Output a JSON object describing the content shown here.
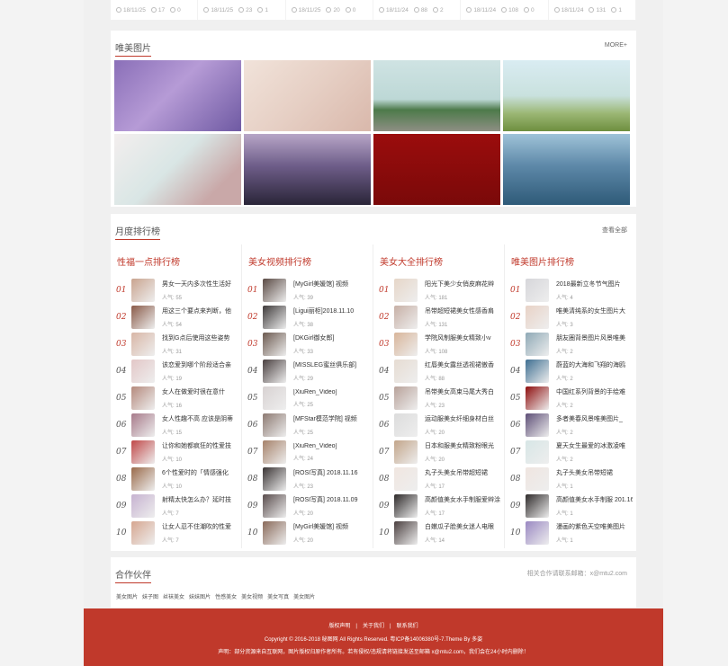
{
  "top_strip": [
    {
      "date": "18/11/25",
      "views": "17",
      "likes": "0"
    },
    {
      "date": "18/11/25",
      "views": "23",
      "likes": "1"
    },
    {
      "date": "18/11/25",
      "views": "20",
      "likes": "0"
    },
    {
      "date": "18/11/24",
      "views": "88",
      "likes": "2"
    },
    {
      "date": "18/11/24",
      "views": "108",
      "likes": "0"
    },
    {
      "date": "18/11/24",
      "views": "131",
      "likes": "1"
    }
  ],
  "gallery": {
    "title": "唯美图片",
    "more": "MORE+",
    "tiles": [
      "linear-gradient(135deg,#8a6fb8,#b69bd6 45%,#6f5aa3)",
      "linear-gradient(135deg,#f1e3da,#e6cfc4 50%,#d9b8ab)",
      "linear-gradient(180deg,#cfe3e3 0%,#bdd8d6 55%,#4d7a4a 70%,#8e8f84 100%)",
      "linear-gradient(180deg,#d9ecf2 0%,#c9e1de 50%,#9bb774 75%,#6e8f3f 100%)",
      "linear-gradient(135deg,#f3eeee,#d9e6e5 45%,#c9a8a8 80%)",
      "linear-gradient(180deg,#b7a6c7 0%,#6e5d89 45%,#2a2538 100%)",
      "linear-gradient(180deg,#9b0d0d,#7a0909)",
      "linear-gradient(180deg,#9fc3d8 0%,#5d88a8 45%,#2e5a78 100%)"
    ]
  },
  "ranking": {
    "title": "月度排行榜",
    "more": "查看全部",
    "columns": [
      {
        "title": "性福一点排行榜",
        "items": [
          {
            "num": "01",
            "title": "男女一天内多次性生活好",
            "pop": "人气: 55",
            "thumb": "#c9a48f"
          },
          {
            "num": "02",
            "title": "用这三个要点来判断，他",
            "pop": "人气: 54",
            "thumb": "#8a5a48"
          },
          {
            "num": "03",
            "title": "找到G点后使用这些姿势",
            "pop": "人气: 31",
            "thumb": "#d8b6a6"
          },
          {
            "num": "04",
            "title": "该恋爱到哪个阶段适合亲",
            "pop": "人气: 19",
            "thumb": "#e3c7c7"
          },
          {
            "num": "05",
            "title": "女人在做爱时很在意什",
            "pop": "人气: 16",
            "thumb": "#b58a7d"
          },
          {
            "num": "06",
            "title": "女人性趣不高 应该是阴蒂",
            "pop": "人气: 15",
            "thumb": "#a77a8a"
          },
          {
            "num": "07",
            "title": "让你和她都疯狂的性爱技",
            "pop": "人气: 10",
            "thumb": "#c04848"
          },
          {
            "num": "08",
            "title": "6个性爱时的「情感强化",
            "pop": "人气: 10",
            "thumb": "#9a6a4a"
          },
          {
            "num": "09",
            "title": "射精太快怎么办？延时技",
            "pop": "人气: 7",
            "thumb": "#c6b2d0"
          },
          {
            "num": "10",
            "title": "让女人忍不住潮吹的性爱",
            "pop": "人气: 7",
            "thumb": "#d6a690"
          }
        ]
      },
      {
        "title": "美女视频排行榜",
        "items": [
          {
            "num": "01",
            "title": "[MyGirl美媛馆] 视频",
            "pop": "人气: 39",
            "thumb": "#5a4a44"
          },
          {
            "num": "02",
            "title": "[Ligui丽柜]2018.11.10",
            "pop": "人气: 38",
            "thumb": "#3e3a3a"
          },
          {
            "num": "03",
            "title": "[DKGirl御女郎]",
            "pop": "人气: 33",
            "thumb": "#6c5a50"
          },
          {
            "num": "04",
            "title": "[MISSLEG蜜丝俱乐部]",
            "pop": "人气: 29",
            "thumb": "#4a4040"
          },
          {
            "num": "05",
            "title": "[XiuRen_Video]",
            "pop": "人气: 25",
            "thumb": "#d8d2d2"
          },
          {
            "num": "06",
            "title": "[MFStar模范学院] 视频",
            "pop": "人气: 25",
            "thumb": "#8d7a72"
          },
          {
            "num": "07",
            "title": "[XiuRen_Video]",
            "pop": "人气: 24",
            "thumb": "#a6826a"
          },
          {
            "num": "08",
            "title": "[ROSI写真] 2018.11.16",
            "pop": "人气: 23",
            "thumb": "#3a3434"
          },
          {
            "num": "09",
            "title": "[ROSI写真] 2018.11.09",
            "pop": "人气: 20",
            "thumb": "#5a4d4d"
          },
          {
            "num": "10",
            "title": "[MyGirl美媛馆] 视频",
            "pop": "人气: 20",
            "thumb": "#8a6a5a"
          }
        ]
      },
      {
        "title": "美女大全排行榜",
        "items": [
          {
            "num": "01",
            "title": "阳光下美少女俏皮麻花辫",
            "pop": "人气: 181",
            "thumb": "#e6d6c8"
          },
          {
            "num": "02",
            "title": "吊带超短裙美女性感香肩",
            "pop": "人气: 131",
            "thumb": "#c7b0a6"
          },
          {
            "num": "03",
            "title": "学院风制服美女精致小v",
            "pop": "人气: 108",
            "thumb": "#d8b59a"
          },
          {
            "num": "04",
            "title": "红唇美女露丝透视裙傲香",
            "pop": "人气: 88",
            "thumb": "#e6dcd2"
          },
          {
            "num": "05",
            "title": "吊带美女高束马尾大秀白",
            "pop": "人气: 23",
            "thumb": "#b8a29a"
          },
          {
            "num": "06",
            "title": "运动服美女纤细身材白丝",
            "pop": "人气: 20",
            "thumb": "#dcdcdc"
          },
          {
            "num": "07",
            "title": "日本和服美女精致粉眼光",
            "pop": "人气: 20",
            "thumb": "#c2a58a"
          },
          {
            "num": "08",
            "title": "丸子头美女吊带超短裙",
            "pop": "人气: 17",
            "thumb": "#f0e6e0"
          },
          {
            "num": "09",
            "title": "高颜值美女水手制服爱辫涂",
            "pop": "人气: 17",
            "thumb": "#2e2a2a"
          },
          {
            "num": "10",
            "title": "白嫩瓜子脸美女迷人电眼",
            "pop": "人气: 14",
            "thumb": "#4a3f3f"
          }
        ]
      },
      {
        "title": "唯美图片排行榜",
        "items": [
          {
            "num": "01",
            "title": "2018最新立冬节气图片",
            "pop": "人气: 4",
            "thumb": "#d6d6da"
          },
          {
            "num": "02",
            "title": "唯美清纯系的女生图片大",
            "pop": "人气: 3",
            "thumb": "#e8d2c6"
          },
          {
            "num": "03",
            "title": "朋友圈背景图片风景唯美",
            "pop": "人气: 2",
            "thumb": "#8fa9b6"
          },
          {
            "num": "04",
            "title": "蔚蓝的大海和飞翔的海鸥",
            "pop": "人气: 2",
            "thumb": "#3f6f92"
          },
          {
            "num": "05",
            "title": "中国红系列背景的手绘难",
            "pop": "人气: 2",
            "thumb": "#8e0e0e"
          },
          {
            "num": "06",
            "title": "多者美春风景唯美图片_",
            "pop": "人气: 2",
            "thumb": "#5e4f77"
          },
          {
            "num": "07",
            "title": "夏天女生最爱的冰激凌唯",
            "pop": "人气: 2",
            "thumb": "#d7e6e6"
          },
          {
            "num": "08",
            "title": "丸子头美女吊带短裙",
            "pop": "人气: 1",
            "thumb": "#efe5e0"
          },
          {
            "num": "09",
            "title": "高颜值美女水手制服 201.16",
            "pop": "人气: 1",
            "thumb": "#2f2b2b"
          },
          {
            "num": "10",
            "title": "漫画的紫色天空唯美图片",
            "pop": "人气: 1",
            "thumb": "#9a88c2"
          }
        ]
      }
    ]
  },
  "partners": {
    "title": "合作伙伴",
    "contact": "相关合作请联系邮箱：x@mtu2.com",
    "links": [
      "美女图片",
      "妹子图",
      "丝袜美女",
      "妹妹图片",
      "性感美女",
      "美女视频",
      "美女写真",
      "美女图片"
    ]
  },
  "footer": {
    "links": [
      "版权声明",
      "|",
      "关于我们",
      "|",
      "联系我们"
    ],
    "copyright": "Copyright © 2016-2018 秘图网 All Rights Reserved. 粤ICP备14006380号-7.Theme By 多姿",
    "disclaimer": "声明：部分资源来自互联网，图片版权归原作者所有。若有侵权/违规请将链接发送至邮箱 x@mtu2.com，我们会在24小时内删除！"
  },
  "colors": {
    "accent": "#c0392b",
    "background": "#f0f0f0"
  }
}
